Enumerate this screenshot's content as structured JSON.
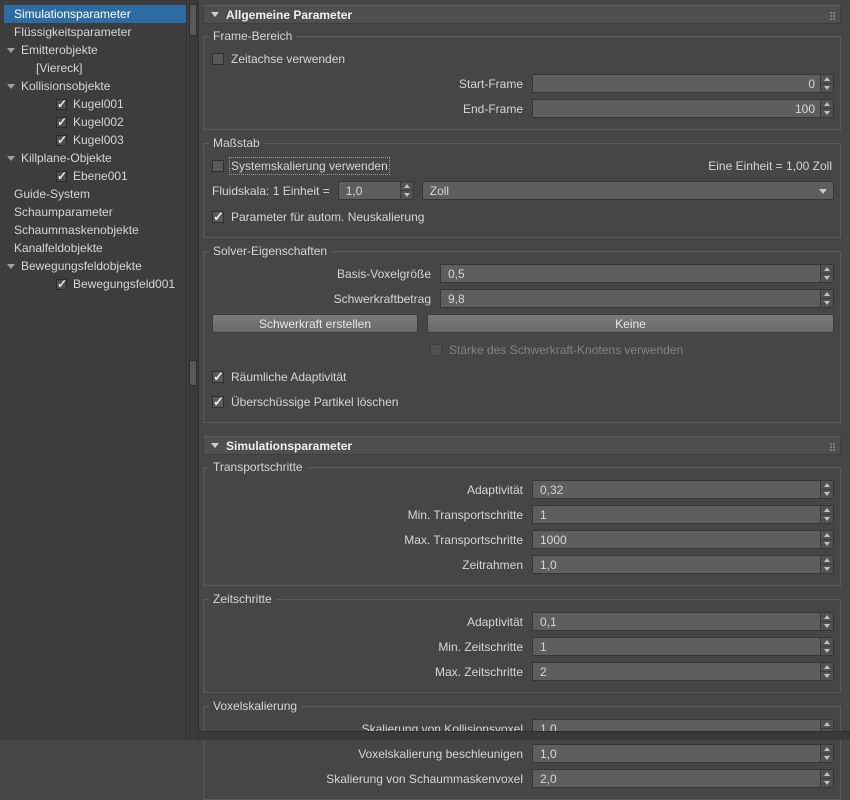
{
  "ui_colors": {
    "selection": "#2d6ca3",
    "panel_bg": "#464646",
    "field_bg": "#5e5e5e"
  },
  "sidebar": {
    "items": [
      {
        "label": "Simulationsparameter",
        "selected": true
      },
      {
        "label": "Flüssigkeitsparameter"
      },
      {
        "label": "Emitterobjekte",
        "expanded": true
      },
      {
        "label": "[Viereck]"
      },
      {
        "label": "Kollisionsobjekte",
        "expanded": true
      },
      {
        "label": "Kugel001",
        "checked": true
      },
      {
        "label": "Kugel002",
        "checked": true
      },
      {
        "label": "Kugel003",
        "checked": true
      },
      {
        "label": "Killplane-Objekte",
        "expanded": true
      },
      {
        "label": "Ebene001",
        "checked": true
      },
      {
        "label": "Guide-System"
      },
      {
        "label": "Schaumparameter"
      },
      {
        "label": "Schaummaskenobjekte"
      },
      {
        "label": "Kanalfeldobjekte"
      },
      {
        "label": "Bewegungsfeldobjekte",
        "expanded": true
      },
      {
        "label": "Bewegungsfeld001",
        "checked": true
      }
    ]
  },
  "rollouts": {
    "general": {
      "title": "Allgemeine Parameter",
      "frame_group": {
        "title": "Frame-Bereich",
        "use_timeline": {
          "label": "Zeitachse verwenden",
          "checked": false
        },
        "start_frame": {
          "label": "Start-Frame",
          "value": "0"
        },
        "end_frame": {
          "label": "End-Frame",
          "value": "100"
        }
      },
      "scale_group": {
        "title": "Maßstab",
        "use_system_scale": {
          "label": "Systemskalierung verwenden",
          "checked": false
        },
        "unit_info": "Eine Einheit = 1,00 Zoll",
        "fluid_scale_label": "Fluidskala: 1 Einheit =",
        "fluid_scale_value": "1,0",
        "unit_select": "Zoll",
        "auto_rescale": {
          "label": "Parameter für autom. Neuskalierung",
          "checked": true
        }
      },
      "solver_group": {
        "title": "Solver-Eigenschaften",
        "voxel_size": {
          "label": "Basis-Voxelgröße",
          "value": "0,5"
        },
        "gravity": {
          "label": "Schwerkraftbetrag",
          "value": "9,8"
        },
        "create_gravity_button": "Schwerkraft erstellen",
        "none_button": "Keine",
        "use_gravity_node": {
          "label": "Stärke des Schwerkraft-Knotens verwenden",
          "checked": false,
          "disabled": true
        },
        "spatial_adaptivity": {
          "label": "Räumliche Adaptivität",
          "checked": true
        },
        "delete_excess": {
          "label": "Überschüssige Partikel löschen",
          "checked": true
        }
      }
    },
    "simulation": {
      "title": "Simulationsparameter",
      "transport_group": {
        "title": "Transportschritte",
        "rows": [
          {
            "label": "Adaptivität",
            "value": "0,32"
          },
          {
            "label": "Min. Transportschritte",
            "value": "1"
          },
          {
            "label": "Max. Transportschritte",
            "value": "1000"
          },
          {
            "label": "Zeitrahmen",
            "value": "1,0"
          }
        ]
      },
      "time_group": {
        "title": "Zeitschritte",
        "rows": [
          {
            "label": "Adaptivität",
            "value": "0,1"
          },
          {
            "label": "Min. Zeitschritte",
            "value": "1"
          },
          {
            "label": "Max. Zeitschritte",
            "value": "2"
          }
        ]
      },
      "voxel_group": {
        "title": "Voxelskalierung",
        "rows": [
          {
            "label": "Skalierung von Kollisionsvoxel",
            "value": "1,0"
          },
          {
            "label": "Voxelskalierung beschleunigen",
            "value": "1,0"
          },
          {
            "label": "Skalierung von Schaummaskenvoxel",
            "value": "2,0"
          }
        ]
      }
    }
  }
}
